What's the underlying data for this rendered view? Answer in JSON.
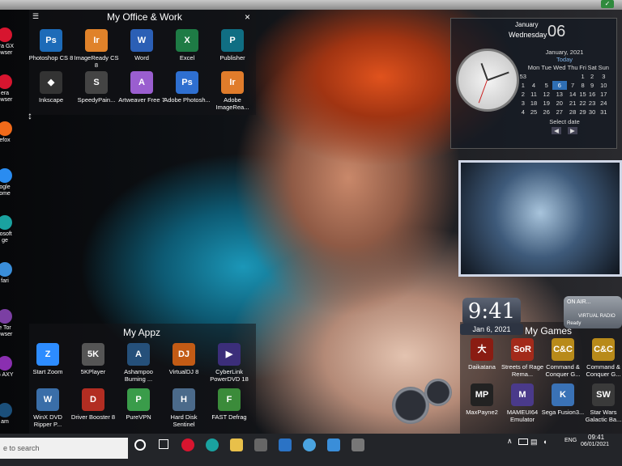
{
  "office_fence": {
    "title": "My Office & Work",
    "close": "×",
    "menu": "☰",
    "icons": [
      {
        "label": "Photoshop CS 8",
        "glyph": "Ps",
        "color": "#1d6bb8"
      },
      {
        "label": "ImageReady CS 8",
        "glyph": "Ir",
        "color": "#e0822a"
      },
      {
        "label": "Word",
        "glyph": "W",
        "color": "#2b5fb5"
      },
      {
        "label": "Excel",
        "glyph": "X",
        "color": "#1e7b45"
      },
      {
        "label": "Publisher",
        "glyph": "P",
        "color": "#106e83"
      },
      {
        "label": "Inkscape",
        "glyph": "◆",
        "color": "#333"
      },
      {
        "label": "SpeedyPain...",
        "glyph": "S",
        "color": "#444"
      },
      {
        "label": "Artweaver Free 7",
        "glyph": "A",
        "color": "#9a5ecf"
      },
      {
        "label": "Adobe Photosh...",
        "glyph": "Ps",
        "color": "#2e6fd0"
      },
      {
        "label": "Adobe ImageRea...",
        "glyph": "Ir",
        "color": "#e07c2b"
      }
    ]
  },
  "appz_fence": {
    "title": "My Appz",
    "icons": [
      {
        "label": "Start Zoom",
        "glyph": "Z",
        "color": "#2d8cff"
      },
      {
        "label": "5KPlayer",
        "glyph": "5K",
        "color": "#555"
      },
      {
        "label": "Ashampoo Burning ...",
        "glyph": "A",
        "color": "#25507a"
      },
      {
        "label": "VirtualDJ 8",
        "glyph": "DJ",
        "color": "#c25b15"
      },
      {
        "label": "CyberLink PowerDVD 18",
        "glyph": "▶",
        "color": "#3b2e7a"
      },
      {
        "label": "WinX DVD Ripper P...",
        "glyph": "W",
        "color": "#3a6ea8"
      },
      {
        "label": "Driver Booster 8",
        "glyph": "D",
        "color": "#b22d22"
      },
      {
        "label": "PureVPN",
        "glyph": "P",
        "color": "#3a9c4a"
      },
      {
        "label": "Hard Disk Sentinel",
        "glyph": "H",
        "color": "#4b6a8a"
      },
      {
        "label": "FAST Defrag",
        "glyph": "F",
        "color": "#3b8b3a"
      }
    ]
  },
  "games_fence": {
    "title": "My Games",
    "icons": [
      {
        "label": "Daikatana",
        "glyph": "大",
        "color": "#8a1c12"
      },
      {
        "label": "Streets of Rage Rema...",
        "glyph": "SoR",
        "color": "#a32a1a"
      },
      {
        "label": "Command & Conquer G...",
        "glyph": "C&C",
        "color": "#b88a1a"
      },
      {
        "label": "Command & Conquer G...",
        "glyph": "C&C",
        "color": "#b88a1a"
      },
      {
        "label": "MaxPayne2",
        "glyph": "MP",
        "color": "#222"
      },
      {
        "label": "MAMEUI64 Emulator",
        "glyph": "M",
        "color": "#4a3a8a"
      },
      {
        "label": "Sega Fusion3...",
        "glyph": "K",
        "color": "#3a72b6"
      },
      {
        "label": "Star Wars Galactic Ba...",
        "glyph": "SW",
        "color": "#3a3a3a"
      }
    ]
  },
  "left_icons": [
    {
      "label": "era GX owser",
      "color": "#d7152f"
    },
    {
      "label": "era owser",
      "color": "#d7152f"
    },
    {
      "label": "efox",
      "color": "#f06a1a"
    },
    {
      "label": "ogle ome",
      "color": "#2a8cf0"
    },
    {
      "label": "rosoft ge",
      "color": "#1aa2a0"
    },
    {
      "label": "fari",
      "color": "#3a8ed9"
    },
    {
      "label": "e Tor owser",
      "color": "#7b3fa3"
    },
    {
      "label": "G AXY",
      "color": "#8a2fb0"
    },
    {
      "label": "am",
      "color": "#1b4f7a"
    }
  ],
  "calendar": {
    "month": "January",
    "weekday": "Wednesday",
    "day": "06",
    "month_year": "January, 2021",
    "today_label": "Today",
    "headers": [
      "",
      "Mon",
      "Tue",
      "Wed",
      "Thu",
      "Fri",
      "Sat",
      "Sun"
    ],
    "rows": [
      [
        "53",
        "",
        "",
        "",
        "",
        "1",
        "2",
        "3"
      ],
      [
        "1",
        "4",
        "5",
        "6",
        "7",
        "8",
        "9",
        "10"
      ],
      [
        "2",
        "11",
        "12",
        "13",
        "14",
        "15",
        "16",
        "17"
      ],
      [
        "3",
        "18",
        "19",
        "20",
        "21",
        "22",
        "23",
        "24"
      ],
      [
        "4",
        "25",
        "26",
        "27",
        "28",
        "29",
        "30",
        "31"
      ]
    ],
    "select_date": "Select date",
    "prev": "◀",
    "next": "▶"
  },
  "digital_clock": {
    "time": "9:41",
    "date": "Jan 6, 2021"
  },
  "radio": {
    "title": "ON AIR...",
    "status": "Ready",
    "brand": "VIRTUAL RADIO"
  },
  "taskbar": {
    "search_placeholder": "e to search",
    "time": "09:41",
    "date": "06/01/2021",
    "lang": "ENG",
    "chevron": "∧"
  }
}
